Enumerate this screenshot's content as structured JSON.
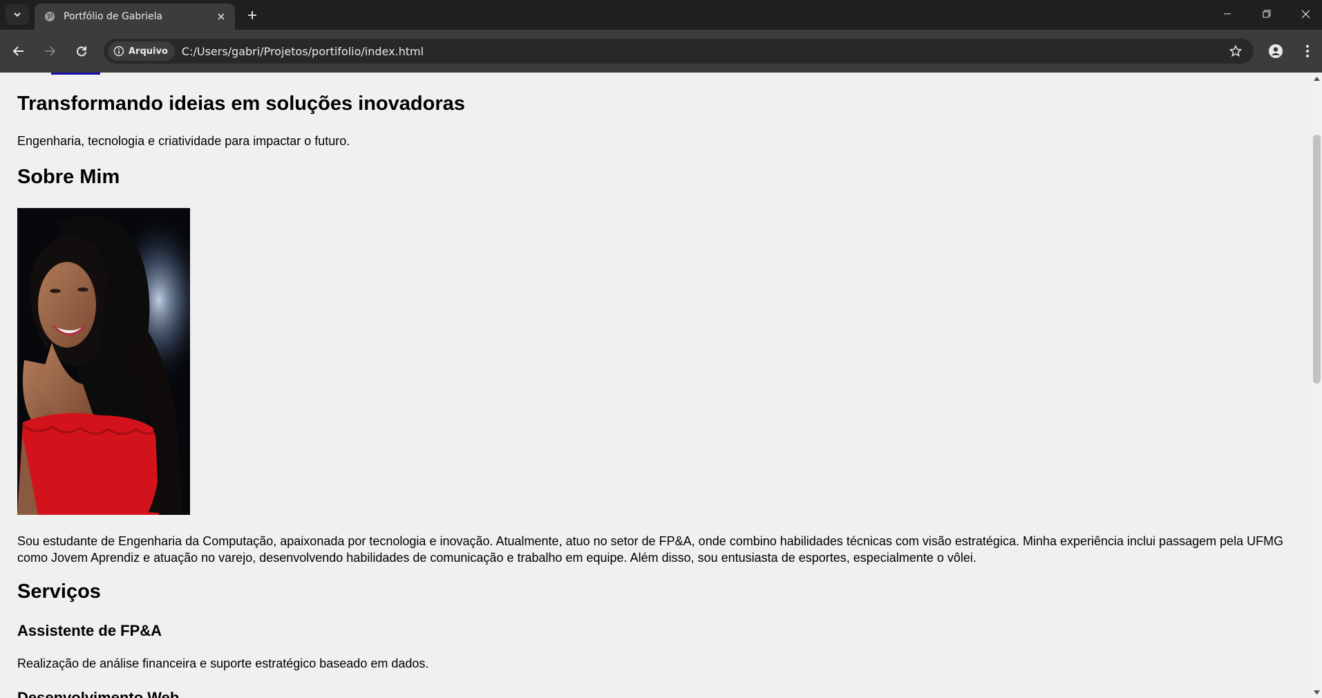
{
  "browser": {
    "tab": {
      "title": "Portfólio de Gabriela",
      "favicon": "globe-icon"
    },
    "omnibox": {
      "site_chip": "Arquivo",
      "url": "C:/Users/gabri/Projetos/portifolio/index.html"
    }
  },
  "page": {
    "hero": {
      "title": "Transformando ideias em soluções inovadoras",
      "subtitle": "Engenharia, tecnologia e criatividade para impactar o futuro."
    },
    "about": {
      "heading": "Sobre Mim",
      "photo": "profile-photo",
      "text": "Sou estudante de Engenharia da Computação, apaixonada por tecnologia e inovação. Atualmente, atuo no setor de FP&A, onde combino habilidades técnicas com visão estratégica. Minha experiência inclui passagem pela UFMG como Jovem Aprendiz e atuação no varejo, desenvolvendo habilidades de comunicação e trabalho em equipe. Além disso, sou entusiasta de esportes, especialmente o vôlei."
    },
    "services": {
      "heading": "Serviços",
      "items": [
        {
          "title": "Assistente de FP&A",
          "description": "Realização de análise financeira e suporte estratégico baseado em dados."
        },
        {
          "title": "Desenvolvimento Web"
        }
      ]
    }
  },
  "colors": {
    "page_background": "#f0f0f0",
    "browser_chrome": "#3c3c3c",
    "tab_strip": "#1f1f1f",
    "link": "#1a0dab"
  }
}
